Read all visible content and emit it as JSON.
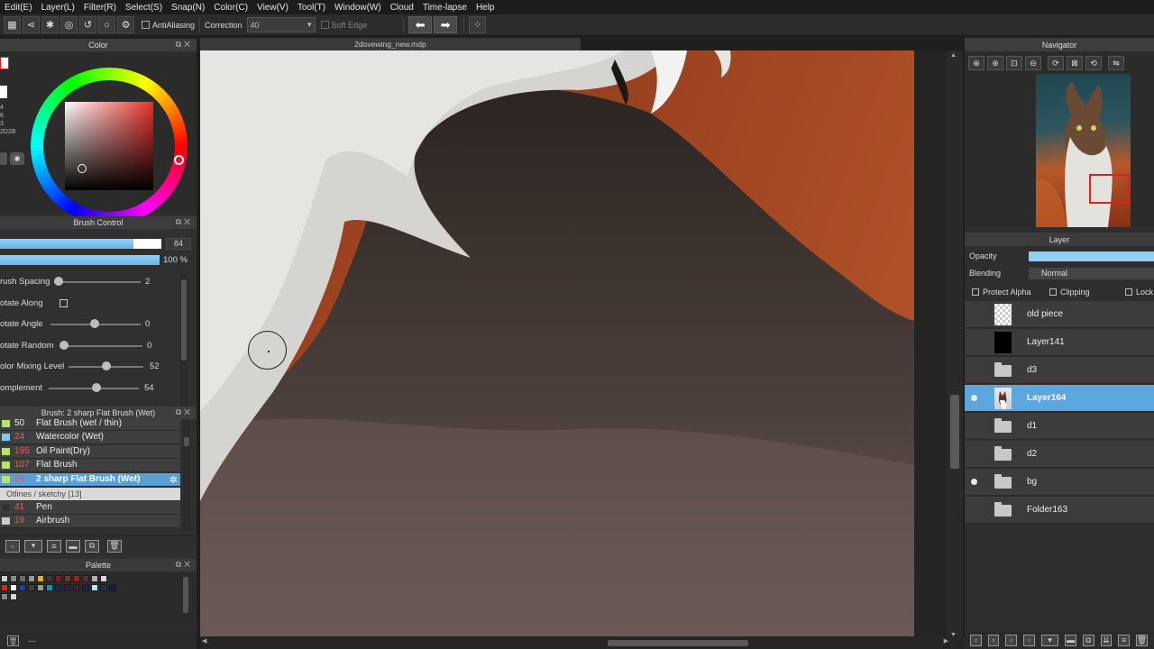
{
  "menu": [
    "Edit(E)",
    "Layer(L)",
    "Filter(R)",
    "Select(S)",
    "Snap(N)",
    "Color(C)",
    "View(V)",
    "Tool(T)",
    "Window(W)",
    "Cloud",
    "Time-lapse",
    "Help"
  ],
  "toolbar": {
    "antialiasing_label": "AntiAliasing",
    "correction_label": "Correction",
    "correction_value": "40",
    "soft_edge_label": "Soft Edge"
  },
  "color_panel": {
    "title": "Color",
    "side_values": [
      "4",
      "6",
      "3",
      "2D2B"
    ],
    "colors": {
      "wheel_ring": "conic",
      "square_hue": "#e8312a"
    }
  },
  "brush_control": {
    "title": "Brush Control",
    "size_value": "84",
    "size_fill": 0.82,
    "opacity_value": "100 %",
    "opacity_fill": 1.0,
    "sliders": [
      {
        "label": "rush Spacing",
        "value": "2",
        "position": 0.0
      },
      {
        "label": "otate Along",
        "checkbox": true
      },
      {
        "label": "otate Angle",
        "value": "0",
        "position": 0.5
      },
      {
        "label": "otate Random",
        "value": "0",
        "position": 0.0
      },
      {
        "label": "olor Mixing Level",
        "value": "52",
        "position": 0.52
      },
      {
        "label": "omplement",
        "value": "54",
        "position": 0.54
      }
    ]
  },
  "brush_list": {
    "title": "Brush: 2 sharp Flat Brush (Wet)",
    "items": [
      {
        "num": "50",
        "name": "Flat Brush (wet / thin)",
        "swatch": "#b5e46a"
      },
      {
        "num": "24",
        "name": "Watercolor (Wet)",
        "swatch": "#7fc8f0"
      },
      {
        "num": "195",
        "name": "Oil Paint(Dry)",
        "swatch": "#b5e46a"
      },
      {
        "num": "107",
        "name": "Flat Brush",
        "swatch": "#b5e46a"
      },
      {
        "num": "84",
        "name": "2 sharp Flat Brush (Wet)",
        "swatch": "#b5e46a",
        "selected": true
      }
    ],
    "group": "Otlines / sketchy [13]",
    "items2": [
      {
        "num": "41",
        "name": "Pen",
        "swatch": "#333333"
      },
      {
        "num": "19",
        "name": "Airbrush",
        "swatch": "#cccccc"
      }
    ]
  },
  "palette": {
    "title": "Palette",
    "row1": [
      "#d0d0d0",
      "#8a8a8a",
      "#6a6a6a",
      "#9a9a9a",
      "#e2b400",
      "#3a3a3a",
      "#8a1a1a",
      "#6b3a2a",
      "#a02020",
      "#503030",
      "#b0b0b0",
      "#d8d8d8"
    ],
    "row2": [
      "#e02020",
      "#ffffff",
      "#2040a0",
      "#404040",
      "#9a9a9a",
      "#2090b0",
      "#103050",
      "#302040",
      "#402030",
      "#202040",
      "#a0f0f0",
      "#203050",
      "#1a1a40"
    ],
    "row3": [
      "#8a8a8a",
      "#d8d8d8"
    ],
    "footer": "---"
  },
  "canvas": {
    "filename": "2dovewing_new.mdp"
  },
  "navigator": {
    "title": "Navigator"
  },
  "layer_panel": {
    "title": "Layer",
    "opacity_label": "Opacity",
    "blending_label": "Blending",
    "blending_value": "Normal",
    "protect_alpha_label": "Protect Alpha",
    "clipping_label": "Clipping",
    "lock_label": "Lock",
    "layers": [
      {
        "name": "old piece",
        "kind": "image",
        "thumb": "checker",
        "visible": false
      },
      {
        "name": "Layer141",
        "kind": "image",
        "thumb": "black",
        "visible": false
      },
      {
        "name": "d3",
        "kind": "folder",
        "visible": false
      },
      {
        "name": "Layer164",
        "kind": "image",
        "thumb": "art",
        "visible": true,
        "selected": true
      },
      {
        "name": "d1",
        "kind": "folder",
        "visible": false
      },
      {
        "name": "d2",
        "kind": "folder",
        "visible": false
      },
      {
        "name": "bg",
        "kind": "folder",
        "visible": true
      },
      {
        "name": "Folder163",
        "kind": "folder",
        "visible": false
      }
    ]
  }
}
